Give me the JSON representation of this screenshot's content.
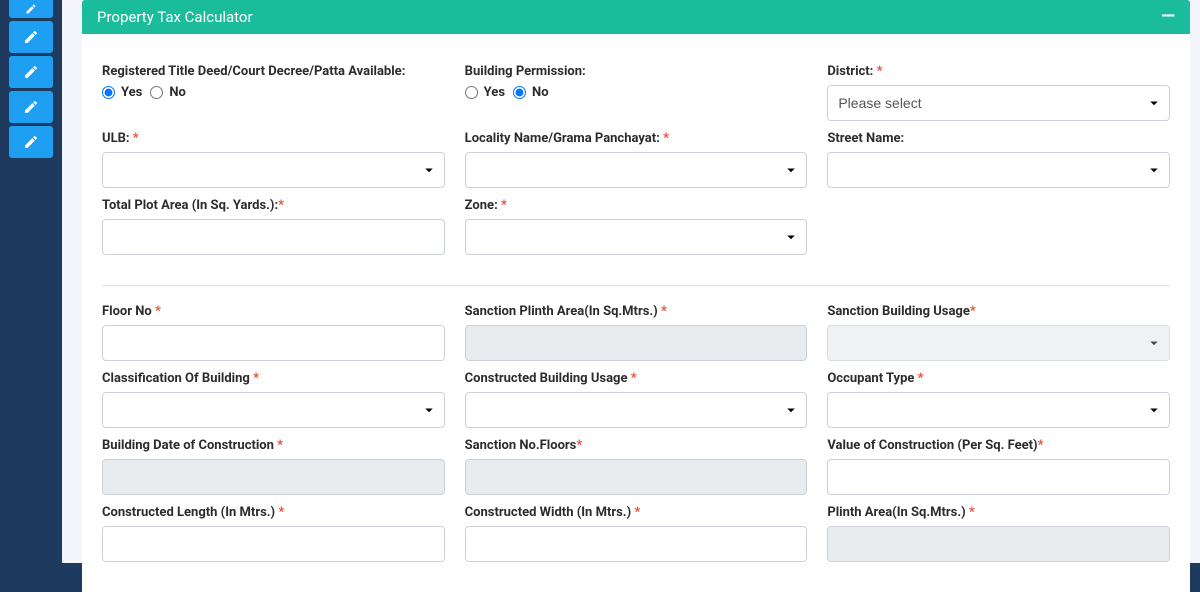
{
  "sidebar": {
    "icon": "edit-icon"
  },
  "panel": {
    "title": "Property Tax Calculator"
  },
  "section1": {
    "titleDeed": {
      "label": "Registered Title Deed/Court Decree/Patta Available:",
      "yes": "Yes",
      "no": "No",
      "value": "yes"
    },
    "buildingPermission": {
      "label": "Building Permission:",
      "yes": "Yes",
      "no": "No",
      "value": "no"
    },
    "district": {
      "label": "District:",
      "placeholder": "Please select"
    },
    "ulb": {
      "label": "ULB:"
    },
    "locality": {
      "label": "Locality Name/Grama Panchayat:"
    },
    "streetName": {
      "label": "Street Name:"
    },
    "totalPlotArea": {
      "label": "Total Plot Area (In Sq. Yards.):"
    },
    "zone": {
      "label": "Zone:"
    }
  },
  "section2": {
    "floorNo": {
      "label": "Floor No"
    },
    "sanctionPlinthArea": {
      "label": "Sanction Plinth Area(In Sq.Mtrs.)"
    },
    "sanctionBuildingUsage": {
      "label": "Sanction Building Usage"
    },
    "classification": {
      "label": "Classification Of Building"
    },
    "constructedUsage": {
      "label": "Constructed Building Usage"
    },
    "occupantType": {
      "label": "Occupant Type"
    },
    "buildingDate": {
      "label": "Building Date of Construction"
    },
    "sanctionFloors": {
      "label": "Sanction No.Floors"
    },
    "valueConstruction": {
      "label": "Value of Construction (Per Sq. Feet)"
    },
    "constructedLength": {
      "label": "Constructed Length (In Mtrs.)"
    },
    "constructedWidth": {
      "label": "Constructed Width (In Mtrs.)"
    },
    "plinthArea": {
      "label": "Plinth Area(In Sq.Mtrs.)"
    }
  }
}
